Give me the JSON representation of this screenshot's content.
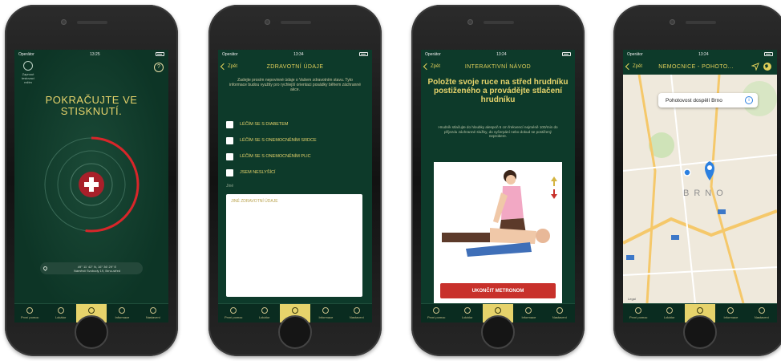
{
  "tabs": [
    {
      "label": "První pomoc",
      "icon": "first-aid-icon"
    },
    {
      "label": "Lokátor",
      "icon": "locator-icon"
    },
    {
      "label": "ALARM",
      "icon": "bell-icon"
    },
    {
      "label": "Informace",
      "icon": "info-icon"
    },
    {
      "label": "Nastavení",
      "icon": "settings-icon"
    }
  ],
  "phone1": {
    "status": {
      "carrier": "Operátor",
      "time": "13:25"
    },
    "lock_label": "Zapnout testovací režim",
    "help": "?",
    "title": "POKRAČUJTE VE STISKNUTÍ.",
    "progress": 0.52,
    "location_coords": "49° 11' 42\" N, 16° 36' 29\" E",
    "location_address": "Náměstí Svobody 19, Brno-střed",
    "active_tab": 2
  },
  "phone2": {
    "status": {
      "carrier": "Operátor",
      "time": "13:34"
    },
    "back": "Zpět",
    "title": "ZDRAVOTNÍ ÚDAJE",
    "intro": "Zadejte prosím nepovinné údaje o Vašem zdravotním stavu. Tyto informace budou využity pro rychlejší orientaci posádky během záchranné akce.",
    "conditions": [
      "LÉČÍM SE S DIABETEM",
      "LÉČÍM SE S ONEMOCNĚNÍM SRDCE",
      "LÉČÍM SE S ONEMOCNĚNÍM PLIC",
      "JSEM NESLYŠÍCÍ"
    ],
    "other_label": "Jiné",
    "other_placeholder": "JINÉ ZDRAVOTNÍ ÚDAJE",
    "active_tab": 2
  },
  "phone3": {
    "status": {
      "carrier": "Operátor",
      "time": "13:24"
    },
    "back": "Zpět",
    "title": "INTERAKTIVNÍ NÁVOD",
    "heading": "Položte svoje ruce na střed hrudníku postiženého a provádějte stlačení hrudníku",
    "subtext": "Hrudník stlačujte do hloubky alespoň 5 cm frekvencí nejméně 100/min do příjezdu záchranné služby, do vyčerpání nebo dokud se postižený neprobere.",
    "button": "UKONČIT METRONOM",
    "active_tab": 2
  },
  "phone4": {
    "status": {
      "carrier": "Operátor",
      "time": "13:24"
    },
    "back": "Zpět",
    "title": "NEMOCNICE - POHOTO...",
    "callout": "Pohotovost dospělí Brno",
    "city": "BRNO",
    "legal": "Legal",
    "active_tab": 2
  },
  "colors": {
    "bg": "#0d3a2a",
    "accent": "#e6d36b",
    "button": "#c8312b",
    "ring": "#d8262a"
  }
}
